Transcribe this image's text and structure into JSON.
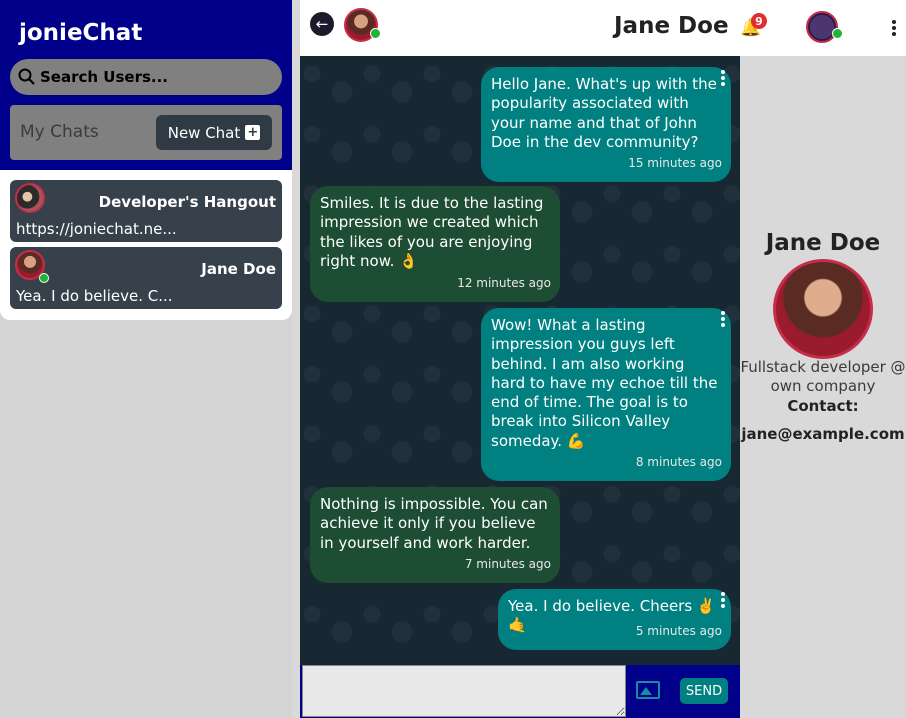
{
  "app": {
    "brand": "jonieChat"
  },
  "sidebar": {
    "search_placeholder": "Search Users...",
    "my_chats_label": "My Chats",
    "new_chat_label": "New Chat",
    "chats": [
      {
        "name": "Developer's Hangout",
        "preview": "https://joniechat.ne...",
        "online": false
      },
      {
        "name": "Jane Doe",
        "preview": "Yea. I do believe. C...",
        "online": true
      }
    ]
  },
  "header": {
    "title": "Jane Doe",
    "notification_count": "9"
  },
  "messages": [
    {
      "type": "sent",
      "text": "Hello Jane. What's up with the popularity associated with your name and that of John Doe in the dev community?",
      "time": "15 minutes ago"
    },
    {
      "type": "recv",
      "text": "Smiles. It is due to the lasting impression we created which the likes of you are enjoying right now. 👌",
      "time": "12 minutes ago"
    },
    {
      "type": "sent",
      "text": "Wow! What a lasting impression you guys left behind. I am also working hard to have my echoe till the end of time. The goal is to break into Silicon Valley someday. 💪",
      "time": "8 minutes ago"
    },
    {
      "type": "recv",
      "text": "Nothing is impossible. You can achieve it only if you believe in yourself and work harder.",
      "time": "7 minutes ago"
    },
    {
      "type": "sent",
      "text": "Yea. I do believe. Cheers ✌️🤙",
      "time": "5 minutes ago"
    }
  ],
  "composer": {
    "send_label": "SEND"
  },
  "profile": {
    "name": "Jane Doe",
    "bio": "Fullstack developer @ own company",
    "contact_label": "Contact:",
    "email": "jane@example.com"
  },
  "colors": {
    "brand": "#00008b",
    "sent_bubble": "#008080",
    "received_bubble": "#1d4d32",
    "online": "#1db533",
    "badge": "#e12d2d"
  }
}
